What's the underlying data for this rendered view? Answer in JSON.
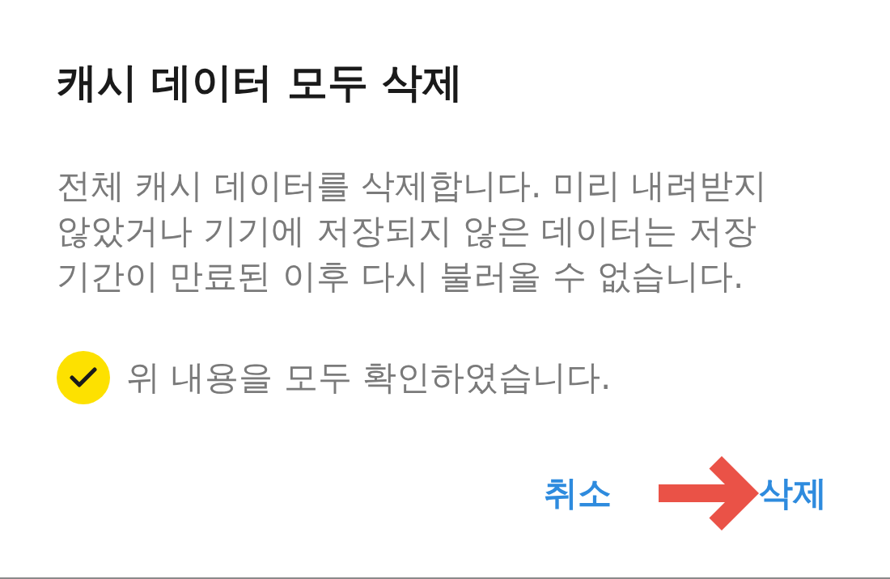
{
  "dialog": {
    "title": "캐시 데이터 모두 삭제",
    "message": "전체 캐시 데이터를 삭제합니다. 미리 내려받지 않았거나 기기에 저장되지 않은 데이터는 저장 기간이 만료된 이후 다시 불러올 수 없습니다.",
    "confirmation": {
      "label": "위 내용을 모두 확인하였습니다.",
      "checked": true
    },
    "buttons": [
      {
        "label": "취소",
        "highlighted": false
      },
      {
        "label": "삭제",
        "highlighted": true
      }
    ]
  }
}
